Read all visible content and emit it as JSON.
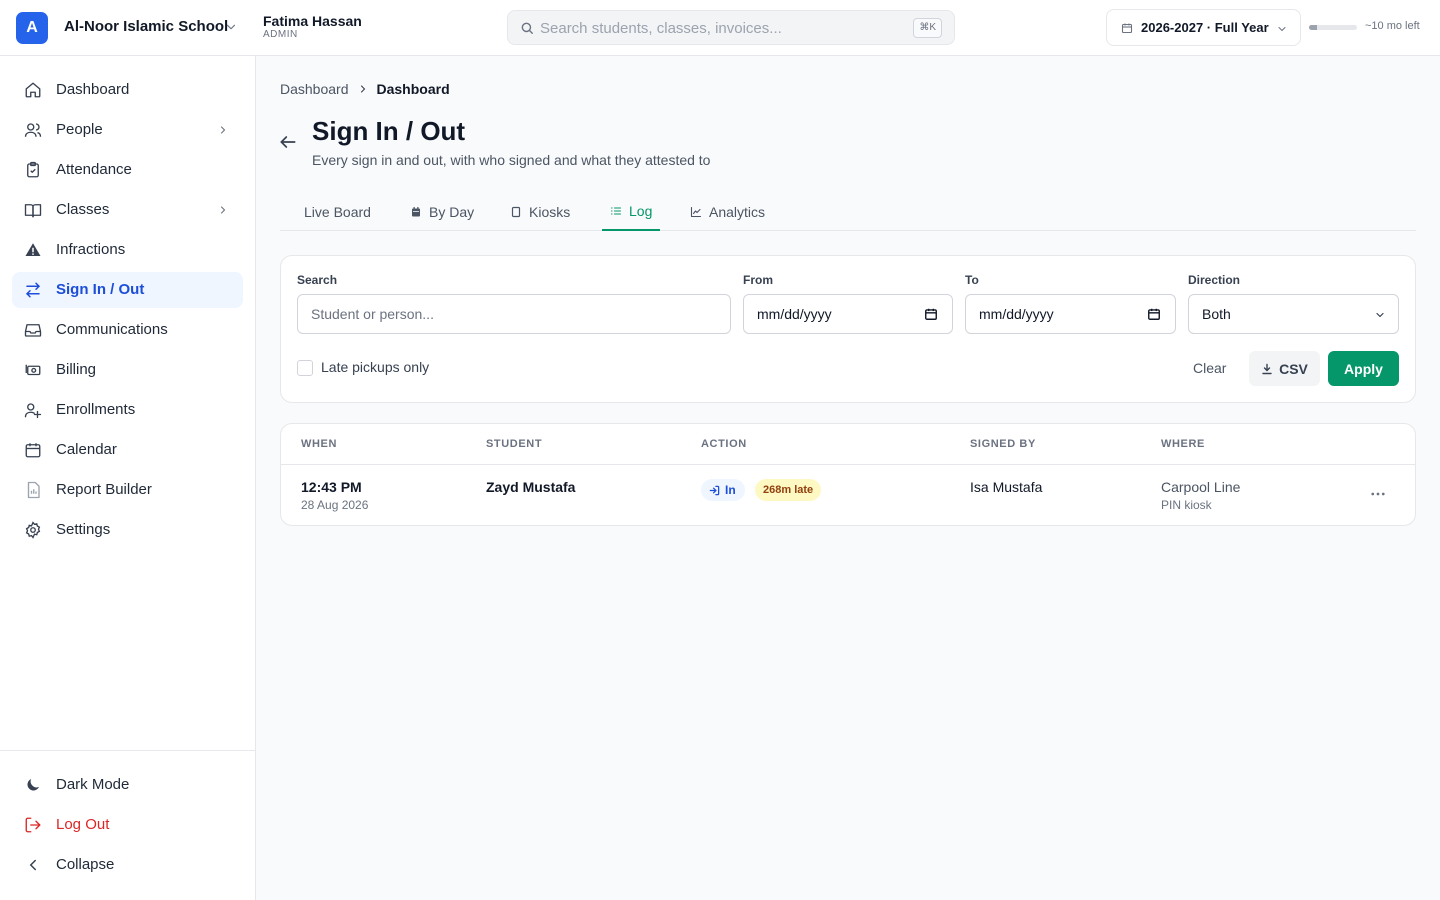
{
  "topbar": {
    "school_initial": "A",
    "school_name": "Al-Noor Islamic School",
    "user_name": "Fatima Hassan",
    "user_role": "ADMIN",
    "search_placeholder": "Search students, classes, invoices...",
    "search_shortcut": "⌘K",
    "year_label": "2026-2027 · Full Year",
    "year_progress": 0.17,
    "time_left": "~10 mo left"
  },
  "sidebar": {
    "items": [
      {
        "label": "Dashboard",
        "icon": "home-icon"
      },
      {
        "label": "People",
        "icon": "users-icon",
        "has_children": true
      },
      {
        "label": "Attendance",
        "icon": "clipboard-check-icon"
      },
      {
        "label": "Classes",
        "icon": "book-open-icon",
        "has_children": true
      },
      {
        "label": "Infractions",
        "icon": "warning-icon"
      },
      {
        "label": "Sign In / Out",
        "icon": "arrows-swap-icon",
        "active": true
      },
      {
        "label": "Communications",
        "icon": "inbox-icon"
      },
      {
        "label": "Billing",
        "icon": "money-icon"
      },
      {
        "label": "Enrollments",
        "icon": "user-plus-icon"
      },
      {
        "label": "Calendar",
        "icon": "calendar-icon"
      },
      {
        "label": "Report Builder",
        "icon": "report-icon"
      },
      {
        "label": "Settings",
        "icon": "gear-icon"
      }
    ],
    "bottom": {
      "dark_mode": "Dark Mode",
      "log_out": "Log Out",
      "collapse": "Collapse"
    }
  },
  "main": {
    "breadcrumb": [
      "Dashboard",
      "Dashboard"
    ],
    "title": "Sign In / Out",
    "subtitle": "Every sign in and out, with who signed and what they attested to",
    "tabs": [
      {
        "label": "Live Board",
        "icon": ""
      },
      {
        "label": "By Day",
        "icon": "calendar-icon"
      },
      {
        "label": "Kiosks",
        "icon": "tablet-icon"
      },
      {
        "label": "Log",
        "icon": "list-icon",
        "active": true
      },
      {
        "label": "Analytics",
        "icon": "chart-line-icon"
      }
    ],
    "filters": {
      "search_label": "Search",
      "search_placeholder": "Student or person...",
      "from_label": "From",
      "from_value": "mm/dd/yyyy",
      "to_label": "To",
      "to_value": "mm/dd/yyyy",
      "direction_label": "Direction",
      "direction_value": "Both",
      "late_only_label": "Late pickups only",
      "late_only_checked": false,
      "clear_label": "Clear",
      "csv_label": "CSV",
      "apply_label": "Apply"
    },
    "table": {
      "columns": [
        "WHEN",
        "STUDENT",
        "ACTION",
        "SIGNED BY",
        "WHERE"
      ],
      "rows": [
        {
          "time": "12:43 PM",
          "date": "28 Aug 2026",
          "student": "Zayd Mustafa",
          "action": "In",
          "late": "268m late",
          "signed_by": "Isa Mustafa",
          "where": "Carpool Line",
          "where_sub": "PIN kiosk"
        }
      ]
    }
  },
  "colors": {
    "brand": "#2563eb",
    "accent": "#059669",
    "danger": "#dc2626",
    "active_nav_bg": "#eff6ff"
  }
}
